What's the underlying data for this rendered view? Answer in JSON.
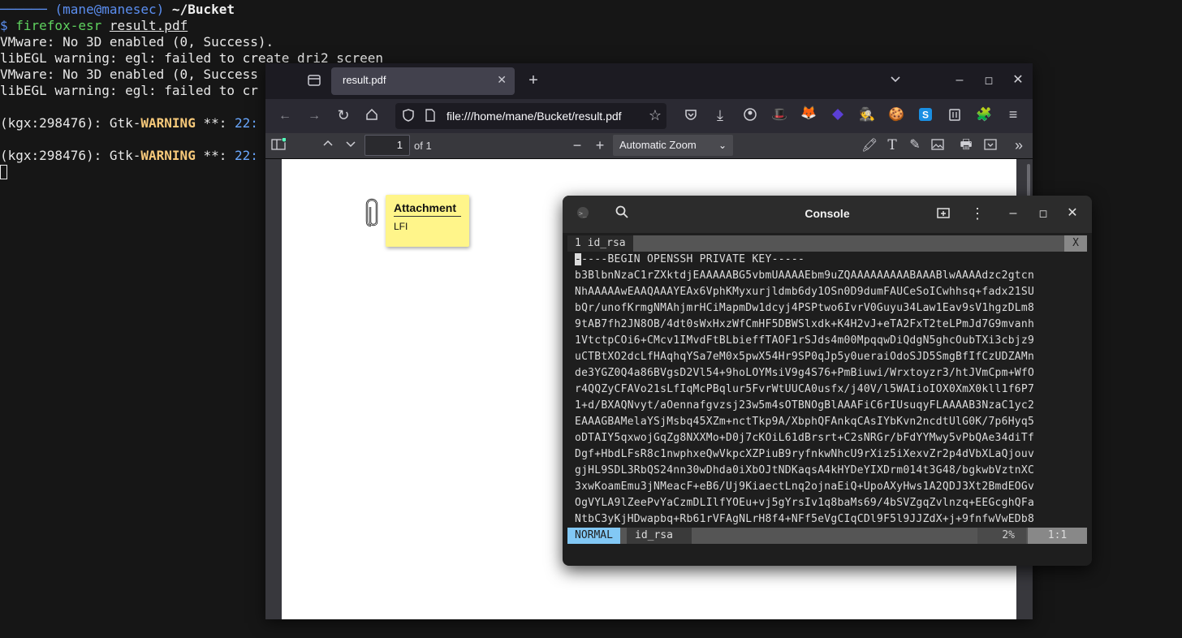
{
  "terminal": {
    "prompt_dash": "────── ",
    "prompt_user": "(mane@manesec)",
    "prompt_dir": " ~/Bucket",
    "dollar": "$ ",
    "command": "firefox-esr",
    "command_arg": "result.pdf",
    "out1": "VMware: No 3D enabled (0, Success).",
    "out2": "libEGL warning: egl: failed to create dri2 screen",
    "out3": "VMware: No 3D enabled (0, Success",
    "out4": "libEGL warning: egl: failed to cr",
    "gtk_prefix": "(kgx:298476): Gtk-",
    "gtk_warn": "WARNING",
    "gtk_mid": " **: ",
    "gtk_time": "22:"
  },
  "firefox": {
    "tab_title": "result.pdf",
    "url": "file:///home/mane/Bucket/result.pdf",
    "page_number": "1",
    "page_of": "of 1",
    "zoom": "Automatic Zoom"
  },
  "pdf": {
    "note_title": "Attachment",
    "note_body": "LFI"
  },
  "console": {
    "title": "Console",
    "vim_tab": "1 id_rsa",
    "vim_tab_close": "X",
    "key_first_char": "-",
    "key_first_rest": "----BEGIN OPENSSH PRIVATE KEY-----",
    "key_lines": [
      "b3BlbnNzaC1rZXktdjEAAAAABG5vbmUAAAAEbm9uZQAAAAAAAAABAAABlwAAAAdzc2gtcn",
      "NhAAAAAwEAAQAAAYEAx6VphKMyxurjldmb6dy1OSn0D9dumFAUCeSoICwhhsq+fadx21SU",
      "bQr/unofKrmgNMAhjmrHCiMapmDw1dcyj4PSPtwo6IvrV0Guyu34Law1Eav9sV1hgzDLm8",
      "9tAB7fh2JN8OB/4dt0sWxHxzWfCmHF5DBWSlxdk+K4H2vJ+eTA2FxT2teLPmJd7G9mvanh",
      "1VtctpCOi6+CMcv1IMvdFtBLbieffTAOF1rSJds4m00MpqqwDiQdgN5ghcOubTXi3cbjz9",
      "uCTBtXO2dcLfHAqhqYSa7eM0x5pwX54Hr9SP0qJp5y0ueraiOdoSJD5SmgBfIfCzUDZAMn",
      "de3YGZ0Q4a86BVgsD2Vl54+9hoLOYMsiV9g4S76+PmBiuwi/Wrxtoyzr3/htJVmCpm+WfO",
      "r4QQZyCFAVo21sLfIqMcPBqlur5FvrWtUUCA0usfx/j40V/l5WAIioIOX0XmX0kll1f6P7",
      "1+d/BXAQNvyt/aOennafgvzsj23w5m4sOTBNOgBlAAAFiC6rIUsuqyFLAAAAB3NzaC1yc2",
      "EAAAGBAMelaYSjMsbq45XZm+nctTkp9A/XbphQFAnkqCAsIYbKvn2ncdtUlG0K/7p6Hyq5",
      "oDTAIY5qxwojGqZg8NXXMo+D0j7cKOiL61dBrsrt+C2sNRGr/bFdYYMwy5vPbQAe34diTf",
      "Dgf+HbdLFsR8c1nwphxeQwVkpcXZPiuB9ryfnkwNhcU9rXiz5iXexvZr2p4dVbXLaQjouv",
      "gjHL9SDL3RbQS24nn30wDhda0iXbOJtNDKaqsA4kHYDeYIXDrm014t3G48/bgkwbVztnXC",
      "3xwKoamEmu3jNMeacF+eB6/Uj9KiaectLnq2ojnaEiQ+UpoAXyHws1A2QDJ3Xt2BmdEOGv",
      "OgVYLA9lZeePvYaCzmDLIlfYOEu+vj5gYrsIv1q8baMs69/4bSVZgqZvlnzq+EEGcghQFa",
      "NtbC3yKjHDwapbq+Rb61rVFAgNLrH8f4+NFf5eVgCIqCDl9F5l9JJZdX+j+9fnfwVwEDb8"
    ],
    "vim_mode": "NORMAL",
    "vim_file": "id_rsa",
    "vim_percent": "2%",
    "vim_position": "1:1"
  }
}
